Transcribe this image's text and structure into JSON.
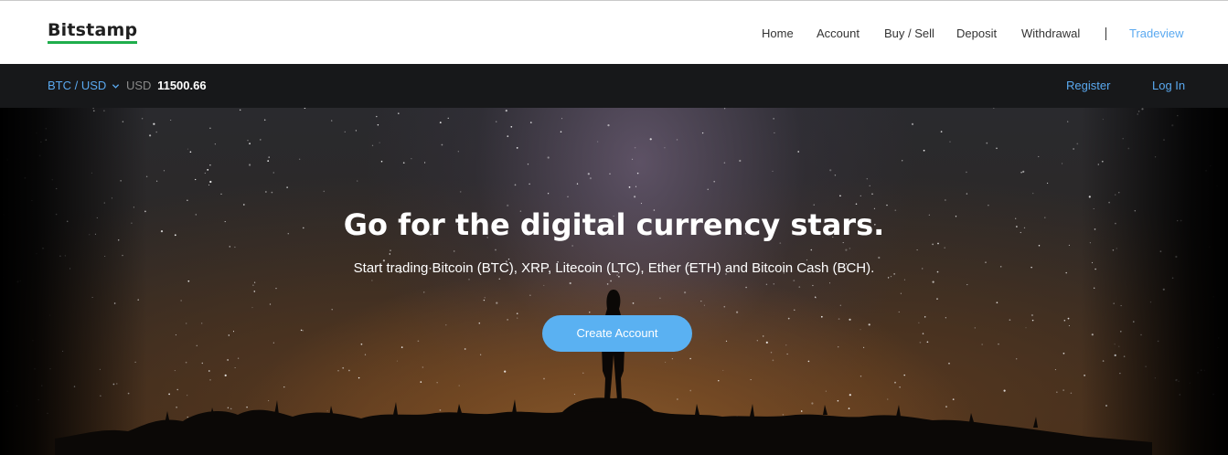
{
  "header": {
    "logo_text": "Bitstamp",
    "brand_underline_color": "#1fae4c",
    "nav": [
      {
        "label": "Home"
      },
      {
        "label": "Account"
      },
      {
        "label": "Buy / Sell"
      },
      {
        "label": "Deposit"
      },
      {
        "label": "Withdrawal"
      },
      {
        "label": "Tradeview"
      }
    ]
  },
  "ticker": {
    "pair_label": "BTC / USD",
    "pair_icon": "chevron-down-icon",
    "currency": "USD",
    "price": "11500.66",
    "register_label": "Register",
    "login_label": "Log In",
    "accent_color": "#5aa9f0"
  },
  "hero": {
    "title": "Go for the digital currency stars.",
    "subtitle": "Start trading Bitcoin (BTC), XRP, Litecoin (LTC), Ether (ETH) and Bitcoin Cash (BCH).",
    "cta_label": "Create Account",
    "cta_color": "#5ab1f2"
  }
}
